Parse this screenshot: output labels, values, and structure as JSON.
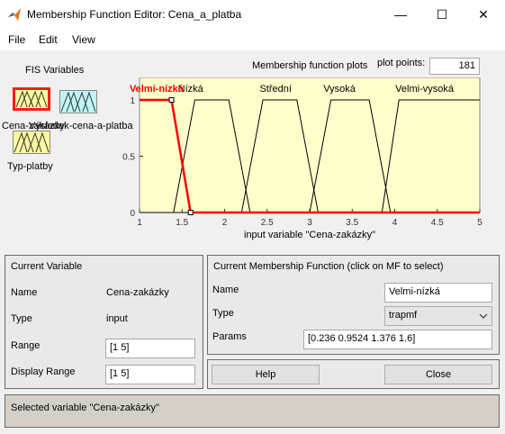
{
  "window": {
    "title": "Membership Function Editor: Cena_a_platba",
    "minimize_glyph": "—",
    "maximize_glyph": "☐",
    "close_glyph": "✕"
  },
  "menu": [
    "File",
    "Edit",
    "View"
  ],
  "fis_variables": {
    "title": "FIS Variables",
    "inputs": [
      "Cena-zakázky",
      "Typ-platby"
    ],
    "output": "Výsledek-cena-a-platba"
  },
  "plot_header": {
    "title": "Membership function plots",
    "points_label": "plot points:",
    "points_value": "181"
  },
  "chart_data": {
    "type": "line",
    "xlabel": "input variable \"Cena-zakázky\"",
    "xlim": [
      1,
      5
    ],
    "ylim": [
      0,
      1
    ],
    "xticks": [
      "1",
      "1.5",
      "2",
      "2.5",
      "3",
      "3.5",
      "4",
      "4.5",
      "5"
    ],
    "yticks": [
      "0",
      "0.5",
      "1"
    ],
    "series": [
      {
        "name": "Velmi-nízká",
        "selected": true,
        "color": "#ff0000",
        "points": [
          [
            1,
            1
          ],
          [
            1.376,
            1
          ],
          [
            1.6,
            0
          ],
          [
            5,
            0
          ]
        ]
      },
      {
        "name": "Nízká",
        "selected": false,
        "color": "#000000",
        "points": [
          [
            1,
            0
          ],
          [
            1.4,
            0
          ],
          [
            1.65,
            1
          ],
          [
            2.05,
            1
          ],
          [
            2.3,
            0
          ],
          [
            5,
            0
          ]
        ]
      },
      {
        "name": "Střední",
        "selected": false,
        "color": "#000000",
        "points": [
          [
            1,
            0
          ],
          [
            2.2,
            0
          ],
          [
            2.45,
            1
          ],
          [
            2.85,
            1
          ],
          [
            3.1,
            0
          ],
          [
            5,
            0
          ]
        ]
      },
      {
        "name": "Vysoká",
        "selected": false,
        "color": "#000000",
        "points": [
          [
            1,
            0
          ],
          [
            3.0,
            0
          ],
          [
            3.25,
            1
          ],
          [
            3.7,
            1
          ],
          [
            3.95,
            0
          ],
          [
            5,
            0
          ]
        ]
      },
      {
        "name": "Velmi-vysoká",
        "selected": false,
        "color": "#000000",
        "points": [
          [
            1,
            0
          ],
          [
            3.85,
            0
          ],
          [
            4.05,
            1
          ],
          [
            5,
            1
          ]
        ]
      }
    ],
    "mf_labels_x": [
      1.2,
      1.6,
      2.6,
      3.35,
      4.35
    ]
  },
  "current_variable": {
    "title": "Current Variable",
    "name_label": "Name",
    "name_value": "Cena-zakázky",
    "type_label": "Type",
    "type_value": "input",
    "range_label": "Range",
    "range_value": "[1 5]",
    "display_range_label": "Display Range",
    "display_range_value": "[1 5]"
  },
  "current_mf": {
    "title": "Current Membership Function (click on MF to select)",
    "name_label": "Name",
    "name_value": "Velmi-nízká",
    "type_label": "Type",
    "type_value": "trapmf",
    "params_label": "Params",
    "params_value": "[0.236 0.9524 1.376 1.6]"
  },
  "buttons": {
    "help": "Help",
    "close": "Close"
  },
  "status": "Selected variable \"Cena-zakázky\""
}
